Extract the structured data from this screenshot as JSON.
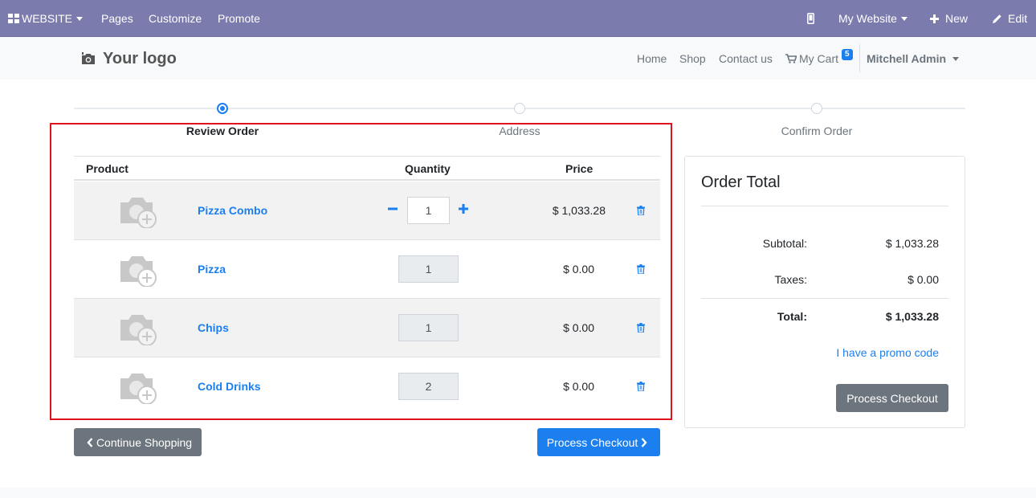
{
  "adminbar": {
    "website_label": "WEBSITE",
    "pages_label": "Pages",
    "customize_label": "Customize",
    "promote_label": "Promote",
    "my_website_label": "My Website",
    "new_label": "New",
    "edit_label": "Edit"
  },
  "header": {
    "logo_text": "Your logo",
    "nav": {
      "home": "Home",
      "shop": "Shop",
      "contact": "Contact us",
      "cart": "My Cart",
      "cart_count": "5"
    },
    "user_name": "Mitchell Admin"
  },
  "steps": [
    {
      "label": "Review Order",
      "active": true
    },
    {
      "label": "Address",
      "active": false
    },
    {
      "label": "Confirm Order",
      "active": false
    }
  ],
  "cart": {
    "columns": {
      "product": "Product",
      "quantity": "Quantity",
      "price": "Price"
    },
    "rows": [
      {
        "name": "Pizza Combo",
        "quantity": "1",
        "price": "$ 1,033.28",
        "editable": true
      },
      {
        "name": "Pizza",
        "quantity": "1",
        "price": "$ 0.00",
        "editable": false
      },
      {
        "name": "Chips",
        "quantity": "1",
        "price": "$ 0.00",
        "editable": false
      },
      {
        "name": "Cold Drinks",
        "quantity": "2",
        "price": "$ 0.00",
        "editable": false
      }
    ]
  },
  "actions": {
    "continue_shopping": "Continue Shopping",
    "process_checkout": "Process Checkout"
  },
  "order_total": {
    "title": "Order Total",
    "subtotal_label": "Subtotal:",
    "subtotal_value": "$ 1,033.28",
    "taxes_label": "Taxes:",
    "taxes_value": "$ 0.00",
    "total_label": "Total:",
    "total_value": "$ 1,033.28",
    "promo_link": "I have a promo code",
    "checkout_button": "Process Checkout"
  },
  "colors": {
    "admin_bar": "#7c7bad",
    "primary": "#1b7fef",
    "secondary": "#6c757d",
    "highlight": "#e0141e"
  }
}
